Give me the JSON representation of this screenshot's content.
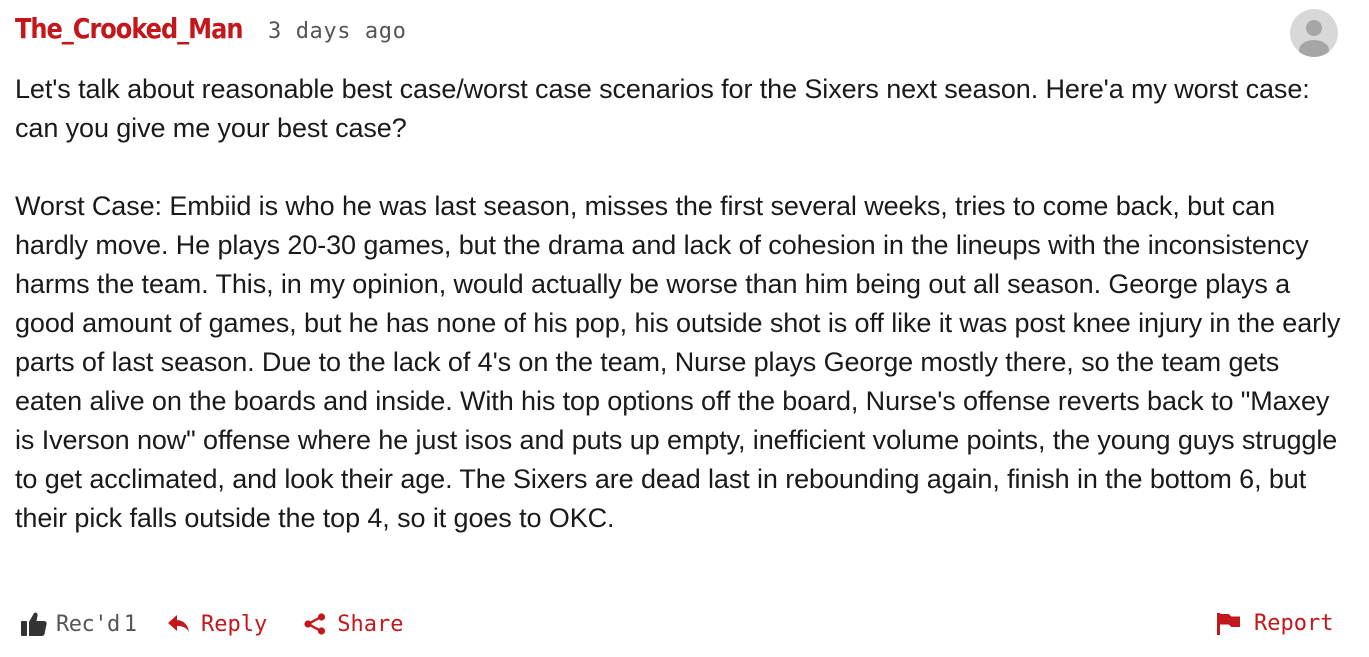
{
  "comment": {
    "author": "The_Crooked_Man",
    "timestamp": "3 days ago",
    "paragraphs": [
      "Let's talk about reasonable best case/worst case scenarios for the Sixers next season. Here'a my worst case: can you give me your best case?",
      "Worst Case: Embiid is who he was last season, misses the first several weeks, tries to come back, but can hardly move. He plays 20-30 games, but the drama and lack of cohesion in the lineups with the inconsistency harms the team. This, in my opinion, would actually be worse than him being out all season. George plays a good amount of games, but he has none of his pop, his outside shot is off like it was post knee injury in the early parts of last season. Due to the lack of 4's on the team, Nurse plays George mostly there, so the team gets eaten alive on the boards and inside. With his top options off the board, Nurse's offense reverts back to \"Maxey is Iverson now\" offense where he just isos and puts up empty, inefficient volume points, the young guys struggle to get acclimated, and look their age. The Sixers are dead last in rebounding again, finish in the bottom 6, but their pick falls outside the top 4, so it goes to OKC."
    ]
  },
  "actions": {
    "rec_label": "Rec'd",
    "rec_count": "1",
    "reply_label": "Reply",
    "share_label": "Share",
    "report_label": "Report"
  },
  "icons": {
    "rec": "thumbs-up-icon",
    "reply": "reply-arrow-icon",
    "share": "share-icon",
    "report": "flag-icon",
    "avatar": "user-avatar-icon"
  },
  "colors": {
    "accent": "#c4171c",
    "text": "#1a1a1a",
    "muted": "#555555",
    "avatar_bg": "#d8d8d8",
    "avatar_fg": "#a6a6a6"
  }
}
